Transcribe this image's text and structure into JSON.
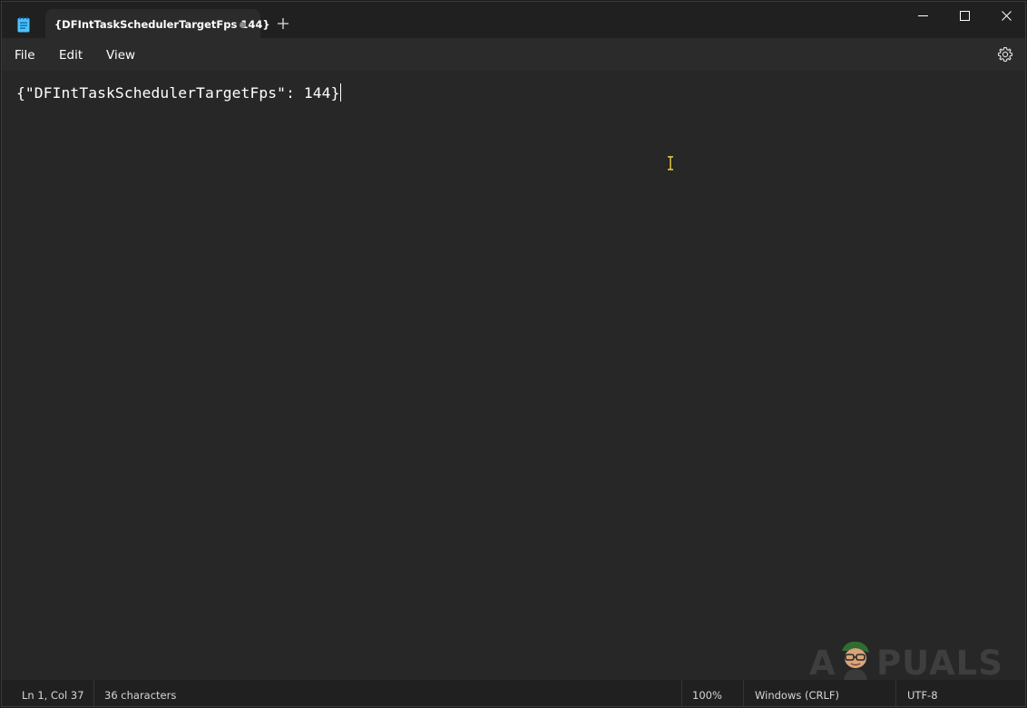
{
  "tab": {
    "title": "{DFIntTaskSchedulerTargetFps 144}"
  },
  "menu": {
    "file": "File",
    "edit": "Edit",
    "view": "View"
  },
  "editor": {
    "text": "{\"DFIntTaskSchedulerTargetFps\": 144}"
  },
  "status": {
    "position": "Ln 1, Col 37",
    "characters": "36 characters",
    "zoom": "100%",
    "line_ending": "Windows (CRLF)",
    "encoding": "UTF-8"
  },
  "watermark": {
    "left": "A",
    "right": "PUALS"
  },
  "icons": {
    "app": "notepad-icon",
    "new_tab": "plus-icon",
    "minimize": "minimize-icon",
    "maximize": "maximize-icon",
    "close": "close-icon",
    "settings": "gear-icon",
    "text_cursor": "ibeam-cursor-icon"
  },
  "colors": {
    "title_bar": "#202020",
    "editor_background": "#272727",
    "tab_background": "#2b2b2b",
    "text": "#ffffff",
    "notepad_icon": "#4cc2ff",
    "cursor": "#f5d547"
  }
}
